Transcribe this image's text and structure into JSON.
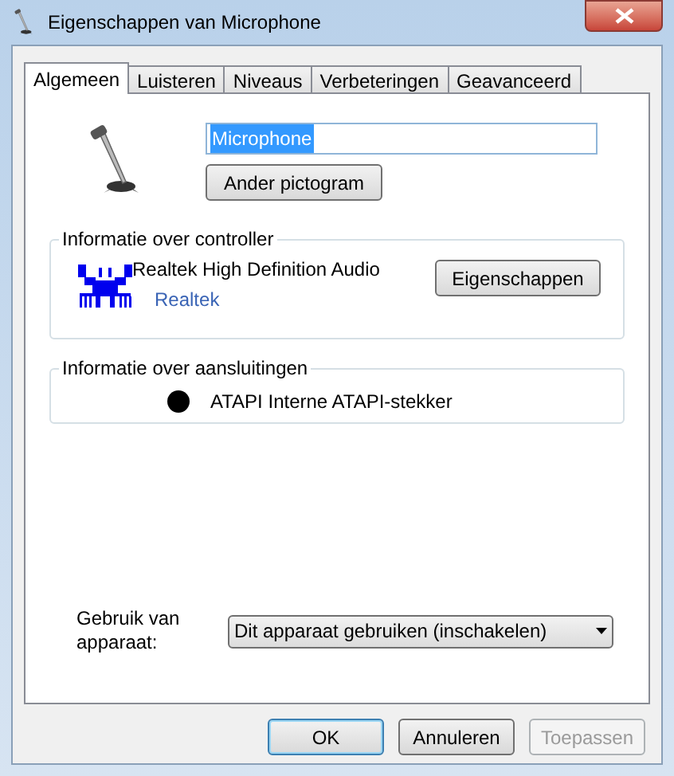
{
  "window": {
    "title": "Eigenschappen van Microphone"
  },
  "tabs": [
    {
      "label": "Algemeen",
      "selected": true
    },
    {
      "label": "Luisteren",
      "selected": false
    },
    {
      "label": "Niveaus",
      "selected": false
    },
    {
      "label": "Verbeteringen",
      "selected": false
    },
    {
      "label": "Geavanceerd",
      "selected": false
    }
  ],
  "device": {
    "name": "Microphone",
    "name_highlighted": true,
    "change_icon_button": "Ander pictogram"
  },
  "controller": {
    "title": "Informatie over controller",
    "name": "Realtek High Definition Audio",
    "vendor_link": "Realtek",
    "properties_button": "Eigenschappen"
  },
  "jacks": {
    "title": "Informatie over aansluitingen",
    "items": [
      {
        "label": "ATAPI Interne ATAPI-stekker",
        "color": "#000000"
      }
    ]
  },
  "device_usage": {
    "label": "Gebruik van apparaat:",
    "value": "Dit apparaat gebruiken (inschakelen)"
  },
  "buttons": [
    {
      "label": "OK",
      "default": true,
      "disabled": false
    },
    {
      "label": "Annuleren",
      "default": false,
      "disabled": false
    },
    {
      "label": "Toepassen",
      "default": false,
      "disabled": true
    }
  ]
}
